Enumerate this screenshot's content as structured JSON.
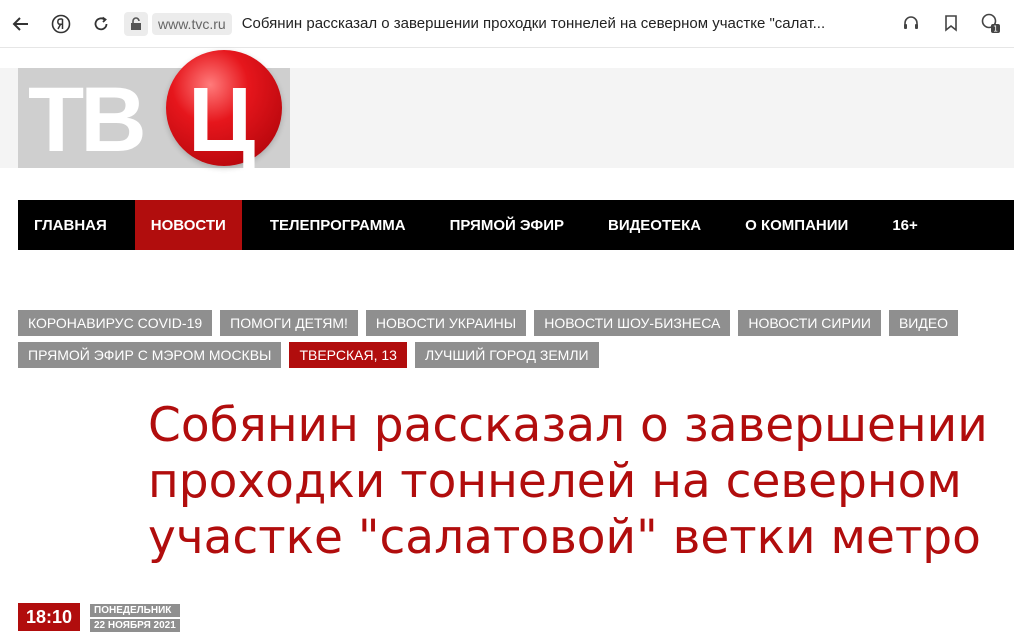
{
  "browser": {
    "domain": "www.tvc.ru",
    "tab_title": "Собянин рассказал о завершении проходки тоннелей на северном участке \"салат..."
  },
  "logo": {
    "letters": "ТВ",
    "ball_letter": "Ц"
  },
  "nav": {
    "items": [
      {
        "label": "ГЛАВНАЯ"
      },
      {
        "label": "НОВОСТИ"
      },
      {
        "label": "ТЕЛЕПРОГРАММА"
      },
      {
        "label": "ПРЯМОЙ ЭФИР"
      },
      {
        "label": "ВИДЕОТЕКА"
      },
      {
        "label": "О КОМПАНИИ"
      },
      {
        "label": "16+"
      }
    ]
  },
  "tags": [
    {
      "label": "КОРОНАВИРУС COVID-19"
    },
    {
      "label": "ПОМОГИ ДЕТЯМ!"
    },
    {
      "label": "НОВОСТИ УКРАИНЫ"
    },
    {
      "label": "НОВОСТИ ШОУ-БИЗНЕСА"
    },
    {
      "label": "НОВОСТИ СИРИИ"
    },
    {
      "label": "ВИДЕО"
    },
    {
      "label": "ПРЯМОЙ ЭФИР С МЭРОМ МОСКВЫ"
    },
    {
      "label": "ТВЕРСКАЯ, 13"
    },
    {
      "label": "ЛУЧШИЙ ГОРОД ЗЕМЛИ"
    }
  ],
  "article": {
    "headline": "Собянин рассказал о завершении проходки тоннелей на северном участке \"салатовой\" ветки метро",
    "time": "18:10",
    "weekday": "ПОНЕДЕЛЬНИК",
    "date": "22 НОЯБРЯ 2021"
  },
  "colors": {
    "accent": "#b10d0d",
    "nav_bg": "#000000",
    "tag_bg": "#8f8f8f"
  }
}
